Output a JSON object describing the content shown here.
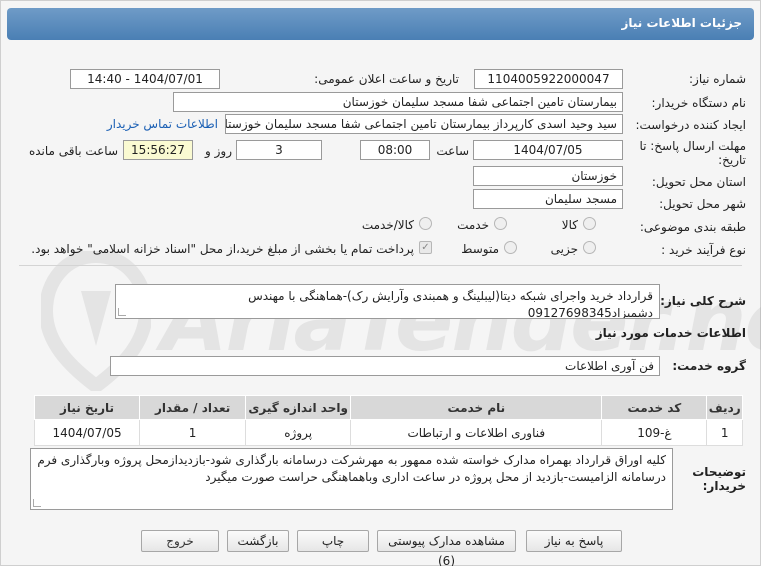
{
  "header": {
    "title": "جزئیات اطلاعات نیاز"
  },
  "form": {
    "need_number_label": "شماره نیاز:",
    "need_number": "1104005922000047",
    "announce_label": "تاریخ و ساعت اعلان عمومی:",
    "announce_value": "1404/07/01 - 14:40",
    "buyer_org_label": "نام دستگاه خریدار:",
    "buyer_org": "بیمارستان تامین اجتماعی شفا مسجد سلیمان خوزستان",
    "requester_label": "ایجاد کننده درخواست:",
    "requester": "سید وحید اسدی کارپرداز بیمارستان تامین اجتماعی شفا مسجد سلیمان خوزستان",
    "contact_link": "اطلاعات تماس خریدار",
    "deadline_label": "مهلت ارسال پاسخ: تا",
    "deadline_label2": "تاریخ:",
    "deadline_date": "1404/07/05",
    "time_label": "ساعت",
    "deadline_time": "08:00",
    "days_value": "3",
    "days_label": "روز و",
    "remaining_time": "15:56:27",
    "remaining_label": "ساعت باقی مانده",
    "province_label": "استان محل تحویل:",
    "province": "خوزستان",
    "city_label": "شهر محل تحویل:",
    "city": "مسجد سلیمان",
    "category_label": "طبقه بندی موضوعی:",
    "category_options": [
      "کالا",
      "خدمت",
      "کالا/خدمت"
    ],
    "purchase_type_label": "نوع فرآیند خرید :",
    "purchase_options": [
      "جزیی",
      "متوسط"
    ],
    "payment_note": "پرداخت تمام یا بخشی از مبلغ خرید،از محل \"اسناد خزانه اسلامی\" خواهد بود."
  },
  "description": {
    "label": "شرح کلی نیاز:",
    "text": "قرارداد خرید واجرای شبکه دیتا(لیبلینگ و همبندی وآرایش رک)-هماهنگی با مهندس دشمیزاد09127698345"
  },
  "services": {
    "section_title": "اطلاعات خدمات مورد نیاز",
    "group_label": "گروه خدمت:",
    "group_value": "فن آوری اطلاعات",
    "columns": [
      "ردیف",
      "کد خدمت",
      "نام خدمت",
      "واحد اندازه گیری",
      "تعداد / مقدار",
      "تاریخ نیاز"
    ],
    "rows": [
      [
        "1",
        "غ-109",
        "فناوری اطلاعات و ارتباطات",
        "پروژه",
        "1",
        "1404/07/05"
      ]
    ]
  },
  "buyer_notes": {
    "label": "توضیحات",
    "label2": "خریدار:",
    "text": "کلیه اوراق قرارداد بهمراه مدارک خواسته شده ممهور به مهرشرکت درسامانه بارگذاری شود-بازدیدازمحل پروژه وبارگذاری فرم درسامانه الزامیست-بازدید از محل پروژه در ساعت اداری وباهماهنگی حراست صورت میگیرد"
  },
  "buttons": {
    "reply": "پاسخ به نیاز",
    "attachments": "مشاهده مدارک پیوستی (6)",
    "print": "چاپ",
    "back": "بازگشت",
    "exit": "خروج"
  },
  "watermark": {
    "text": "AriaTender.net"
  }
}
